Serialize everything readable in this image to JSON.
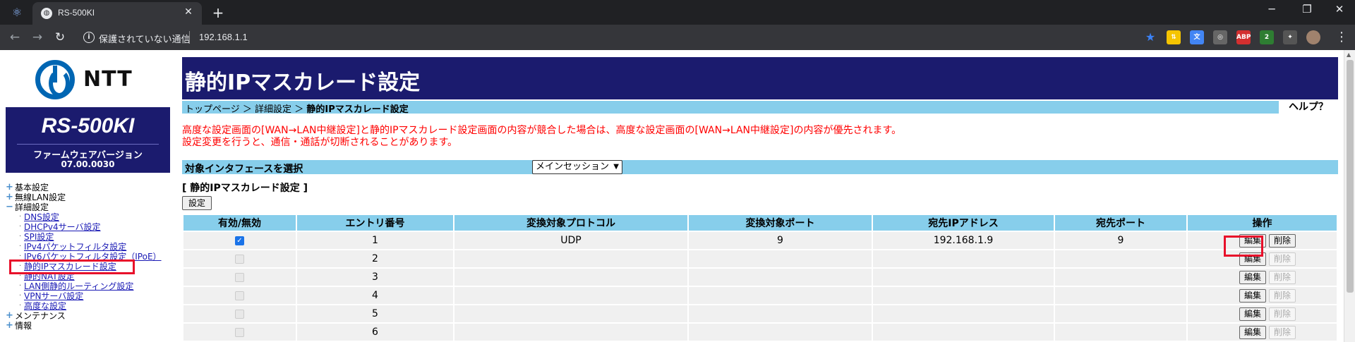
{
  "browser": {
    "tab_title": "RS-500KI",
    "tab_close": "✕",
    "new_tab": "+",
    "security_text": "保護されていない通信",
    "url": "192.168.1.1",
    "window_controls": [
      "─",
      "❐",
      "✕"
    ],
    "extensions": [
      {
        "icon": "bookmark-star-icon",
        "label": "★",
        "color": "#3b82f6"
      },
      {
        "icon": "extension-1-icon",
        "label": "⇅",
        "color": "#f5c400"
      },
      {
        "icon": "translate-icon",
        "label": "文",
        "color": "#4285f4"
      },
      {
        "icon": "extension-2-icon",
        "label": "◎",
        "color": "#666666"
      },
      {
        "icon": "adblock-icon",
        "label": "ABP",
        "color": "#d32f2f"
      },
      {
        "icon": "extension-3-icon",
        "label": "2",
        "color": "#2e7d32"
      },
      {
        "icon": "puzzle-icon",
        "label": "✦",
        "color": "#555555"
      },
      {
        "icon": "profile-avatar-icon",
        "label": "",
        "color": "#a0826d"
      }
    ],
    "menu_icon": "⋮"
  },
  "sidebar": {
    "logo_text": "NTT",
    "model": "RS-500KI",
    "fw_label": "ファームウェアバージョン",
    "fw_version": "07.00.0030",
    "menu": [
      {
        "type": "top",
        "label": "基本設定",
        "expandable": true
      },
      {
        "type": "top",
        "label": "無線LAN設定",
        "expandable": true
      },
      {
        "type": "top",
        "label": "詳細設定",
        "expandable": false
      },
      {
        "type": "sub",
        "label": "DNS設定"
      },
      {
        "type": "sub",
        "label": "DHCPv4サーバ設定"
      },
      {
        "type": "sub",
        "label": "SPI設定"
      },
      {
        "type": "sub",
        "label": "IPv4パケットフィルタ設定"
      },
      {
        "type": "sub",
        "label": "IPv6パケットフィルタ設定（IPoE）"
      },
      {
        "type": "sub",
        "label": "静的IPマスカレード設定",
        "highlighted": true
      },
      {
        "type": "sub",
        "label": "静的NAT設定"
      },
      {
        "type": "sub",
        "label": "LAN側静的ルーティング設定"
      },
      {
        "type": "sub",
        "label": "VPNサーバ設定"
      },
      {
        "type": "sub",
        "label": "高度な設定"
      },
      {
        "type": "top",
        "label": "メンテナンス",
        "expandable": true
      },
      {
        "type": "top",
        "label": "情報",
        "expandable": true
      }
    ]
  },
  "main": {
    "title": "静的IPマスカレード設定",
    "breadcrumb": [
      "トップページ",
      "詳細設定",
      "静的IPマスカレード設定"
    ],
    "breadcrumb_sep": "＞",
    "help": "ヘルプ？",
    "warning_line1": "高度な設定画面の[WAN→LAN中継設定]と静的IPマスカレード設定画面の内容が競合した場合は、高度な設定画面の[WAN→LAN中継設定]の内容が優先されます。",
    "warning_line2": "設定変更を行うと、通信・通話が切断されることがあります。",
    "iface_label": "対象インタフェースを選択",
    "iface_selected": "メインセッション",
    "section_title": "[ 静的IPマスカレード設定 ]",
    "set_button": "設定",
    "columns": [
      "有効/無効",
      "エントリ番号",
      "変換対象プロトコル",
      "変換対象ポート",
      "宛先IPアドレス",
      "宛先ポート",
      "操作"
    ],
    "edit_label": "編集",
    "delete_label": "削除",
    "rows": [
      {
        "enabled": true,
        "entry": "1",
        "protocol": "UDP",
        "port": "9",
        "dest_ip": "192.168.1.9",
        "dest_port": "9",
        "active": true
      },
      {
        "enabled": false,
        "entry": "2",
        "protocol": "",
        "port": "",
        "dest_ip": "",
        "dest_port": "",
        "active": false
      },
      {
        "enabled": false,
        "entry": "3",
        "protocol": "",
        "port": "",
        "dest_ip": "",
        "dest_port": "",
        "active": false
      },
      {
        "enabled": false,
        "entry": "4",
        "protocol": "",
        "port": "",
        "dest_ip": "",
        "dest_port": "",
        "active": false
      },
      {
        "enabled": false,
        "entry": "5",
        "protocol": "",
        "port": "",
        "dest_ip": "",
        "dest_port": "",
        "active": false
      },
      {
        "enabled": false,
        "entry": "6",
        "protocol": "",
        "port": "",
        "dest_ip": "",
        "dest_port": "",
        "active": false
      }
    ]
  },
  "colors": {
    "header_navy": "#1b1b6e",
    "sky_blue": "#87ceeb",
    "warning_red": "#ff0000",
    "highlight_red": "#e8102a",
    "link_blue": "#1a1ab5"
  }
}
